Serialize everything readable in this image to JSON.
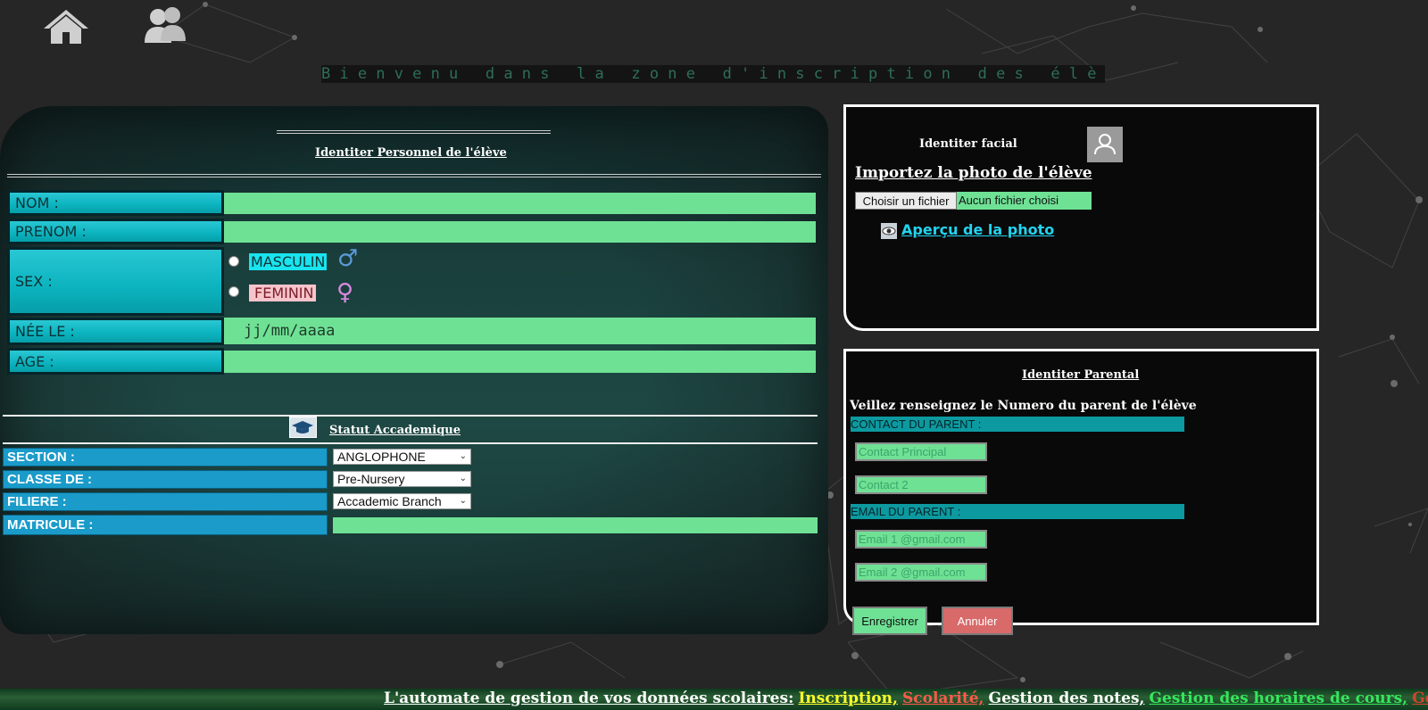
{
  "header": {
    "home_icon": "home-icon",
    "users_icon": "users-icon",
    "welcome": "Bienvenu dans la zone d'inscription des élèves"
  },
  "personal": {
    "title": "Identiter Personnel de l'élève",
    "nom_label": "NOM :",
    "prenom_label": "PRENOM :",
    "sex_label": "SEX :",
    "masculin": "MASCULIN",
    "feminin": "FEMININ",
    "male_symbol": "♂",
    "female_symbol": "♀",
    "nee_label": "NÉE LE :",
    "date_placeholder": "jj/mm/aaaa",
    "age_label": "AGE :"
  },
  "academic": {
    "title": "Statut Accademique",
    "section_label": "SECTION :",
    "section_value": "ANGLOPHONE",
    "classe_label": "CLASSE DE :",
    "classe_value": "Pre-Nursery",
    "filiere_label": "FILIERE :",
    "filiere_value": "Accademic Branch",
    "matricule_label": "MATRICULE :"
  },
  "facial": {
    "title": "Identiter facial",
    "import_title": "Importez la photo de l'élève",
    "choose_button": "Choisir un fichier",
    "no_file": "Aucun fichier choisi",
    "preview_link": "Aperçu de la photo"
  },
  "parental": {
    "title": "Identiter Parental",
    "instruction": "Veillez renseignez le Numero du parent de l'élève",
    "contact_label": "CONTACT DU PARENT :",
    "contact1_placeholder": "Contact Principal",
    "contact2_placeholder": "Contact 2",
    "email_label": "EMAIL DU PARENT :",
    "email1_placeholder": "Email 1 @gmail.com",
    "email2_placeholder": "Email 2 @gmail.com",
    "save_button": "Enregistrer",
    "cancel_button": "Annuler"
  },
  "ticker": {
    "intro": "L'automate de gestion de vos données scolaires:",
    "item1": "Inscription,",
    "item2": "Scolarité,",
    "item3": "Gestion des notes,",
    "item4": "Gestion des horaires de cours,",
    "item5": "Gestion"
  },
  "colors": {
    "field_green": "#6fe195",
    "label_cyan": "#0bb3be",
    "label_blue": "#1a9bc9",
    "teal_header": "#0c9aa0",
    "cancel_red": "#d86a6a"
  }
}
